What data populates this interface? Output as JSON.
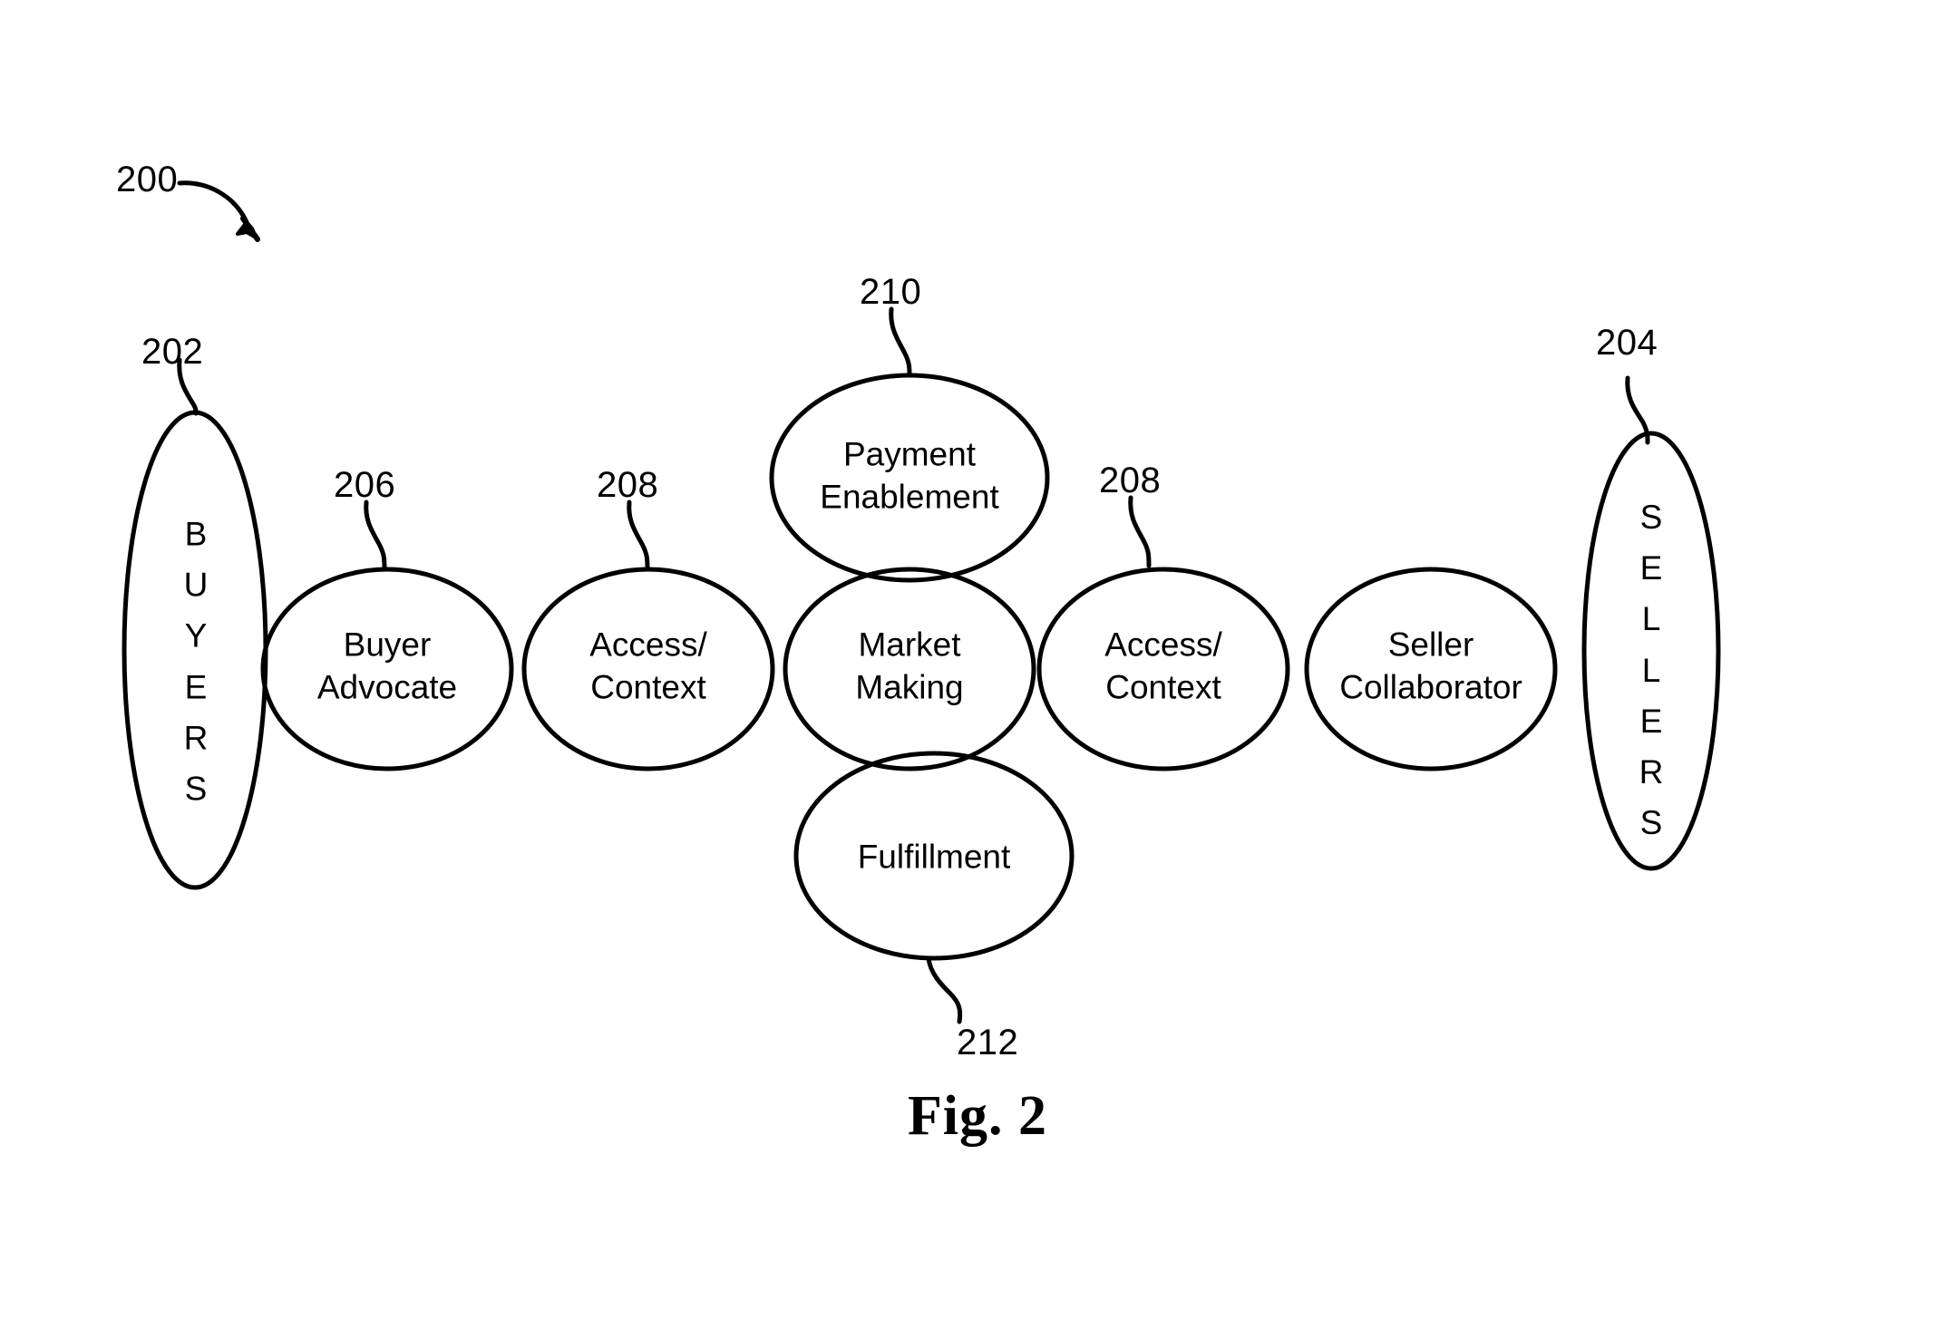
{
  "figure": {
    "caption": "Fig. 2",
    "system_ref": "200"
  },
  "reference_numerals": [
    {
      "id": "200",
      "text": "200",
      "target": "system-overall"
    },
    {
      "id": "202",
      "text": "202",
      "target": "buyers"
    },
    {
      "id": "204",
      "text": "204",
      "target": "sellers"
    },
    {
      "id": "206",
      "text": "206",
      "target": "buyer-advocate"
    },
    {
      "id": "208a",
      "text": "208",
      "target": "access-context-left"
    },
    {
      "id": "208b",
      "text": "208",
      "target": "access-context-right"
    },
    {
      "id": "210",
      "text": "210",
      "target": "payment-enablement"
    },
    {
      "id": "212",
      "text": "212",
      "target": "fulfillment"
    }
  ],
  "endpoints": [
    {
      "id": "buyers",
      "label": "BUYERS",
      "ref": "202"
    },
    {
      "id": "sellers",
      "label": "SELLERS",
      "ref": "204"
    }
  ],
  "nodes": [
    {
      "id": "buyer-advocate",
      "label": "Buyer\nAdvocate",
      "ref": "206"
    },
    {
      "id": "access-context-left",
      "label": "Access/\nContext",
      "ref": "208"
    },
    {
      "id": "market-making",
      "label": "Market\nMaking",
      "ref": ""
    },
    {
      "id": "payment-enablement",
      "label": "Payment\nEnablement",
      "ref": "210"
    },
    {
      "id": "fulfillment",
      "label": "Fulfillment",
      "ref": "212"
    },
    {
      "id": "access-context-right",
      "label": "Access/\nContext",
      "ref": "208"
    },
    {
      "id": "seller-collaborator",
      "label": "Seller\nCollaborator",
      "ref": ""
    }
  ],
  "style": {
    "line_color": "#000000",
    "background_color": "#ffffff",
    "fill": "none"
  }
}
